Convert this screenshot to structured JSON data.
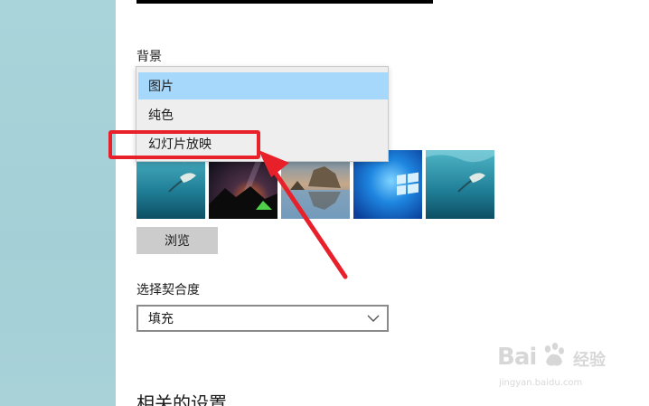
{
  "background": {
    "label": "背景",
    "dropdown_items": [
      {
        "label": "图片",
        "selected": true
      },
      {
        "label": "纯色",
        "selected": false
      },
      {
        "label": "幻灯片放映",
        "selected": false
      }
    ],
    "browse_label": "浏览"
  },
  "fit": {
    "label": "选择契合度",
    "value": "填充"
  },
  "related": {
    "heading": "相关的设置"
  },
  "watermark": {
    "brand": "Bai",
    "brand_cn": "经验",
    "url": "jingyan.baidu.com"
  },
  "colors": {
    "selected_item": "#a6d8fb",
    "annotation_red": "#e8202a",
    "sidebar": "#a9d4da"
  },
  "icons": [
    "chevron-down-icon",
    "windows-logo-icon",
    "baidu-paw-icon"
  ]
}
